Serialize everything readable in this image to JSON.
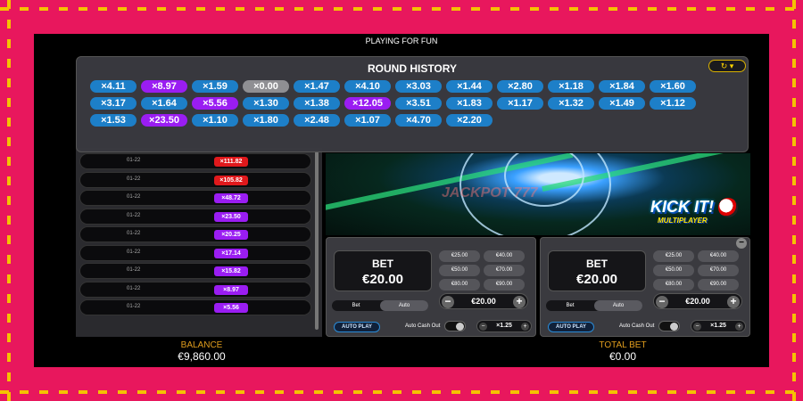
{
  "header": {
    "title": "PLAYING FOR FUN"
  },
  "round_history": {
    "title": "ROUND HISTORY",
    "history_toggle": "↻ ▾",
    "chips": [
      {
        "label": "×4.11",
        "color": "blue"
      },
      {
        "label": "×8.97",
        "color": "purple"
      },
      {
        "label": "×1.59",
        "color": "blue"
      },
      {
        "label": "×0.00",
        "color": "grey"
      },
      {
        "label": "×1.47",
        "color": "blue"
      },
      {
        "label": "×4.10",
        "color": "blue"
      },
      {
        "label": "×3.03",
        "color": "blue"
      },
      {
        "label": "×1.44",
        "color": "blue"
      },
      {
        "label": "×2.80",
        "color": "blue"
      },
      {
        "label": "×1.18",
        "color": "blue"
      },
      {
        "label": "×1.84",
        "color": "blue"
      },
      {
        "label": "×1.60",
        "color": "blue"
      },
      {
        "label": "×3.17",
        "color": "blue"
      },
      {
        "label": "×1.64",
        "color": "blue"
      },
      {
        "label": "×5.56",
        "color": "purple"
      },
      {
        "label": "×1.30",
        "color": "blue"
      },
      {
        "label": "×1.38",
        "color": "blue"
      },
      {
        "label": "×12.05",
        "color": "purple"
      },
      {
        "label": "×3.51",
        "color": "blue"
      },
      {
        "label": "×1.83",
        "color": "blue"
      },
      {
        "label": "×1.17",
        "color": "blue"
      },
      {
        "label": "×1.32",
        "color": "blue"
      },
      {
        "label": "×1.49",
        "color": "blue"
      },
      {
        "label": "×1.12",
        "color": "blue"
      },
      {
        "label": "×1.53",
        "color": "blue"
      },
      {
        "label": "×23.50",
        "color": "purple"
      },
      {
        "label": "×1.10",
        "color": "blue"
      },
      {
        "label": "×1.80",
        "color": "blue"
      },
      {
        "label": "×2.48",
        "color": "blue"
      },
      {
        "label": "×1.07",
        "color": "blue"
      },
      {
        "label": "×4.70",
        "color": "blue"
      },
      {
        "label": "×2.20",
        "color": "blue"
      }
    ]
  },
  "results_list": [
    {
      "time": "01-22",
      "value": "×111.82",
      "color": "red"
    },
    {
      "time": "01-22",
      "value": "×105.82",
      "color": "red"
    },
    {
      "time": "01-22",
      "value": "×48.72",
      "color": "purple"
    },
    {
      "time": "01-22",
      "value": "×23.50",
      "color": "purple"
    },
    {
      "time": "01-22",
      "value": "×20.25",
      "color": "purple"
    },
    {
      "time": "01-22",
      "value": "×17.14",
      "color": "purple"
    },
    {
      "time": "01-22",
      "value": "×15.82",
      "color": "purple"
    },
    {
      "time": "01-22",
      "value": "×8.97",
      "color": "purple"
    },
    {
      "time": "01-22",
      "value": "×5.56",
      "color": "purple"
    }
  ],
  "game_logo": {
    "title": "KICK IT!",
    "subtitle": "MULTIPLAYER"
  },
  "watermark": "JACKPOT 777",
  "bet_panels": [
    {
      "bet_label": "BET",
      "bet_value": "€20.00",
      "quick_bets": [
        "€25.00",
        "€40.00",
        "€50.00",
        "€70.00",
        "€80.00",
        "€90.00"
      ],
      "stepper_value": "€20.00",
      "modes": [
        "Bet",
        "Auto"
      ],
      "active_mode": "Auto",
      "autoplay_label": "AUTO PLAY",
      "cashout_label": "Auto Cash Out",
      "cashout_value": "×1.25"
    },
    {
      "bet_label": "BET",
      "bet_value": "€20.00",
      "quick_bets": [
        "€25.00",
        "€40.00",
        "€50.00",
        "€70.00",
        "€80.00",
        "€90.00"
      ],
      "stepper_value": "€20.00",
      "modes": [
        "Bet",
        "Auto"
      ],
      "active_mode": "Auto",
      "autoplay_label": "AUTO PLAY",
      "cashout_label": "Auto Cash Out",
      "cashout_value": "×1.25"
    }
  ],
  "footer": {
    "balance_label": "BALANCE",
    "balance_value": "€9,860.00",
    "total_bet_label": "TOTAL BET",
    "total_bet_value": "€0.00"
  },
  "colors": {
    "blue": "#1d7fc8",
    "purple": "#9a1df2",
    "grey": "#8f8f93",
    "red": "#e0191c",
    "gold": "#e09d1d",
    "frame": "#e8175d"
  }
}
